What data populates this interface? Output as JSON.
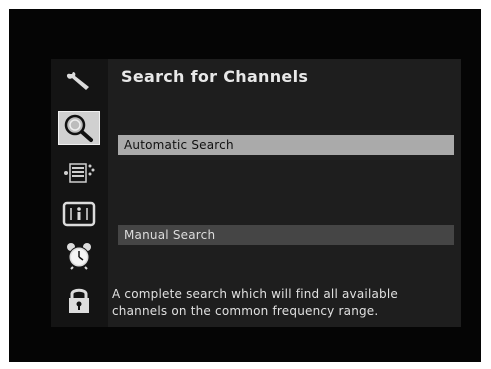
{
  "screen": {
    "title": "Search for Channels",
    "menu": {
      "automatic_search": "Automatic Search",
      "manual_search": "Manual Search"
    },
    "description": {
      "line1": "A complete search which will find all available",
      "line2": "channels on the common frequency range."
    }
  },
  "sidebar": {
    "icons": [
      {
        "name": "wrench-icon",
        "selected": false
      },
      {
        "name": "magnifier-icon",
        "selected": true
      },
      {
        "name": "channel-list-icon",
        "selected": false
      },
      {
        "name": "info-icon",
        "selected": false
      },
      {
        "name": "alarm-clock-icon",
        "selected": false
      },
      {
        "name": "lock-icon",
        "selected": false
      }
    ]
  },
  "colors": {
    "background": "#050505",
    "panel": "#1e1e1e",
    "highlight": "#aaaaaa",
    "item": "#454545",
    "text": "#e8e8e8"
  }
}
